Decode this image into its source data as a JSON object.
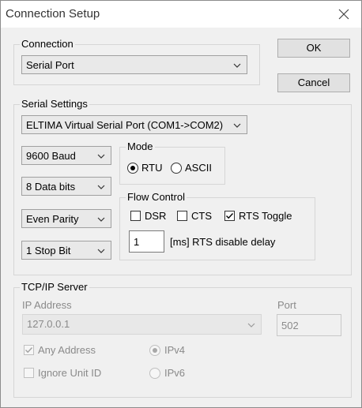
{
  "window": {
    "title": "Connection Setup"
  },
  "buttons": {
    "ok": "OK",
    "cancel": "Cancel"
  },
  "connection": {
    "legend": "Connection",
    "value": "Serial Port"
  },
  "serial": {
    "legend": "Serial Settings",
    "port": "ELTIMA Virtual Serial Port (COM1->COM2)",
    "baud": "9600 Baud",
    "data_bits": "8 Data bits",
    "parity": "Even Parity",
    "stop_bits": "1 Stop Bit",
    "mode": {
      "legend": "Mode",
      "rtu": "RTU",
      "ascii": "ASCII",
      "selected": "RTU"
    },
    "flow": {
      "legend": "Flow Control",
      "dsr": "DSR",
      "dsr_checked": false,
      "cts": "CTS",
      "cts_checked": false,
      "rts_toggle": "RTS Toggle",
      "rts_toggle_checked": true,
      "delay_value": "1",
      "delay_label": "[ms] RTS disable delay"
    }
  },
  "tcp": {
    "legend": "TCP/IP Server",
    "ip_label": "IP Address",
    "ip_value": "127.0.0.1",
    "port_label": "Port",
    "port_value": "502",
    "any_address": "Any Address",
    "any_address_checked": true,
    "ignore_unit": "Ignore Unit ID",
    "ignore_unit_checked": false,
    "ipv4": "IPv4",
    "ipv6": "IPv6",
    "ip_version_selected": "IPv4"
  },
  "icons": {
    "close": "close-icon",
    "dropdown": "chevron-down-icon",
    "check": "checkmark-icon"
  },
  "colors": {
    "group_border": "#d6d6d6",
    "disabled_text": "#8a8a8a",
    "dialog_bg": "#f0f0f0"
  }
}
